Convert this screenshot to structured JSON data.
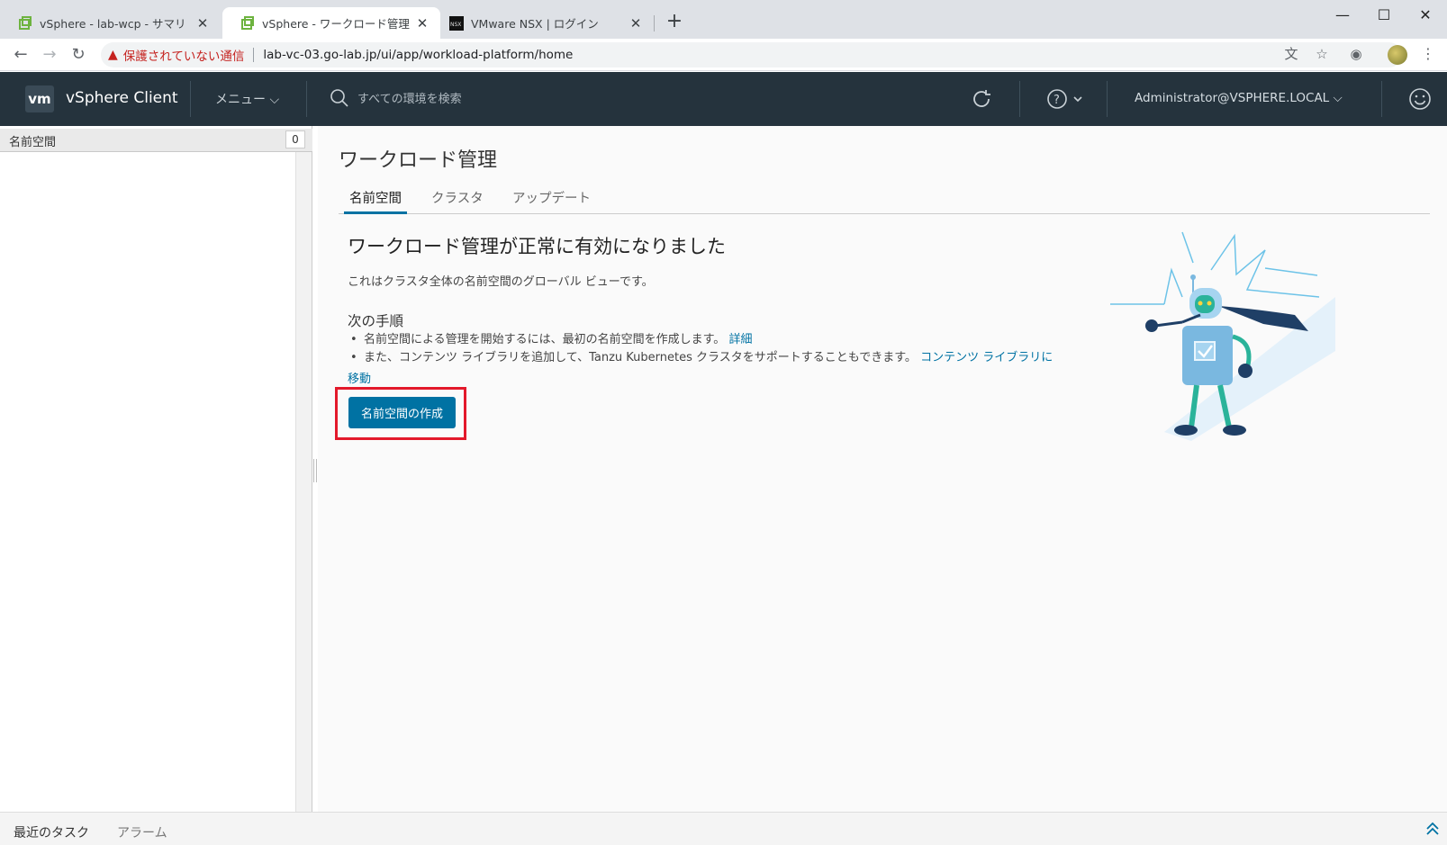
{
  "browser": {
    "tabs": [
      {
        "title": "vSphere - lab-wcp - サマリ",
        "close": "✕"
      },
      {
        "title": "vSphere - ワークロード管理",
        "close": "✕"
      },
      {
        "title": "VMware NSX | ログイン",
        "close": "✕"
      }
    ],
    "new_tab": "+",
    "window_controls": {
      "minimize": "—",
      "maximize": "☐",
      "close": "✕"
    },
    "security_warning": "保護されていない通信",
    "url": "lab-vc-03.go-lab.jp/ui/app/workload-platform/home",
    "nav_back": "←",
    "nav_forward": "→",
    "nav_reload": "↻",
    "translate_icon": "文",
    "bookmark_icon": "☆",
    "extension_icon": "◉",
    "menu_icon": "⋮"
  },
  "vsphere": {
    "logo": "vm",
    "app_title": "vSphere Client",
    "menu_label": "メニュー ⌵",
    "search_placeholder": "すべての環境を検索",
    "user": "Administrator@VSPHERE.LOCAL ⌵"
  },
  "left_panel": {
    "header": "名前空間",
    "count": "0"
  },
  "main": {
    "title": "ワークロード管理",
    "tabs": [
      {
        "label": "名前空間"
      },
      {
        "label": "クラスタ"
      },
      {
        "label": "アップデート"
      }
    ],
    "success_title": "ワークロード管理が正常に有効になりました",
    "description": "これはクラスタ全体の名前空間のグローバル ビューです。",
    "next_steps_title": "次の手順",
    "step1_text": "名前空間による管理を開始するには、最初の名前空間を作成します。",
    "step1_link": "詳細",
    "step2_text": "また、コンテンツ ライブラリを追加して、Tanzu Kubernetes クラスタをサポートすることもできます。",
    "step2_link": "コンテンツ ライブラリに",
    "step2_link_cont": "移動",
    "create_button": "名前空間の作成"
  },
  "bottom": {
    "recent_tasks": "最近のタスク",
    "alarms": "アラーム"
  },
  "colors": {
    "header_bg": "#25333d",
    "accent": "#0072a3",
    "highlight": "#e3192b"
  }
}
